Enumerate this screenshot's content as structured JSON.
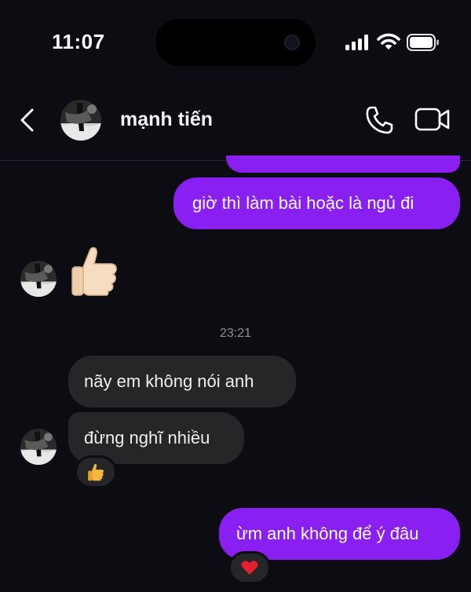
{
  "status_bar": {
    "time": "11:07",
    "icons": [
      "signal-icon",
      "wifi-icon",
      "battery-icon"
    ]
  },
  "header": {
    "contact_name": "mạnh tiến",
    "icons": [
      "back-icon",
      "phone-icon",
      "video-call-icon"
    ]
  },
  "messages": {
    "m1": {
      "direction": "outgoing",
      "text": "giờ thì làm bài hoặc là ngủ đi"
    },
    "m2": {
      "direction": "incoming",
      "content": "thumbs-up-emoji"
    },
    "timestamp": "23:21",
    "m3": {
      "direction": "incoming",
      "text": "nãy em không nói anh"
    },
    "m4": {
      "direction": "incoming",
      "text": "đừng nghĩ nhiều",
      "reaction": "thumbs-up"
    },
    "m5": {
      "direction": "outgoing",
      "text": "ừm anh không để ý đâu",
      "reaction": "heart"
    }
  },
  "colors": {
    "background": "#0c0c12",
    "outgoing_bubble": "#8a1ff2",
    "incoming_bubble": "#262629",
    "timestamp_text": "#8f8f95"
  }
}
